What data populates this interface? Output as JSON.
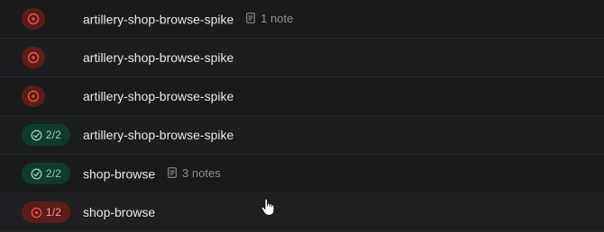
{
  "rows": [
    {
      "status": "fail",
      "count": "",
      "name": "artillery-shop-browse-spike",
      "notes": "1 note"
    },
    {
      "status": "fail",
      "count": "",
      "name": "artillery-shop-browse-spike",
      "notes": ""
    },
    {
      "status": "fail",
      "count": "",
      "name": "artillery-shop-browse-spike",
      "notes": ""
    },
    {
      "status": "pass",
      "count": "2/2",
      "name": "artillery-shop-browse-spike",
      "notes": ""
    },
    {
      "status": "pass",
      "count": "2/2",
      "name": "shop-browse",
      "notes": "3 notes"
    },
    {
      "status": "fail",
      "count": "1/2",
      "name": "shop-browse",
      "notes": ""
    }
  ],
  "colors": {
    "pass_bg": "#0f3b2f",
    "pass_fg": "#8fd3b8",
    "fail_bg": "#5b1c1a",
    "fail_fg": "#e5534b"
  }
}
